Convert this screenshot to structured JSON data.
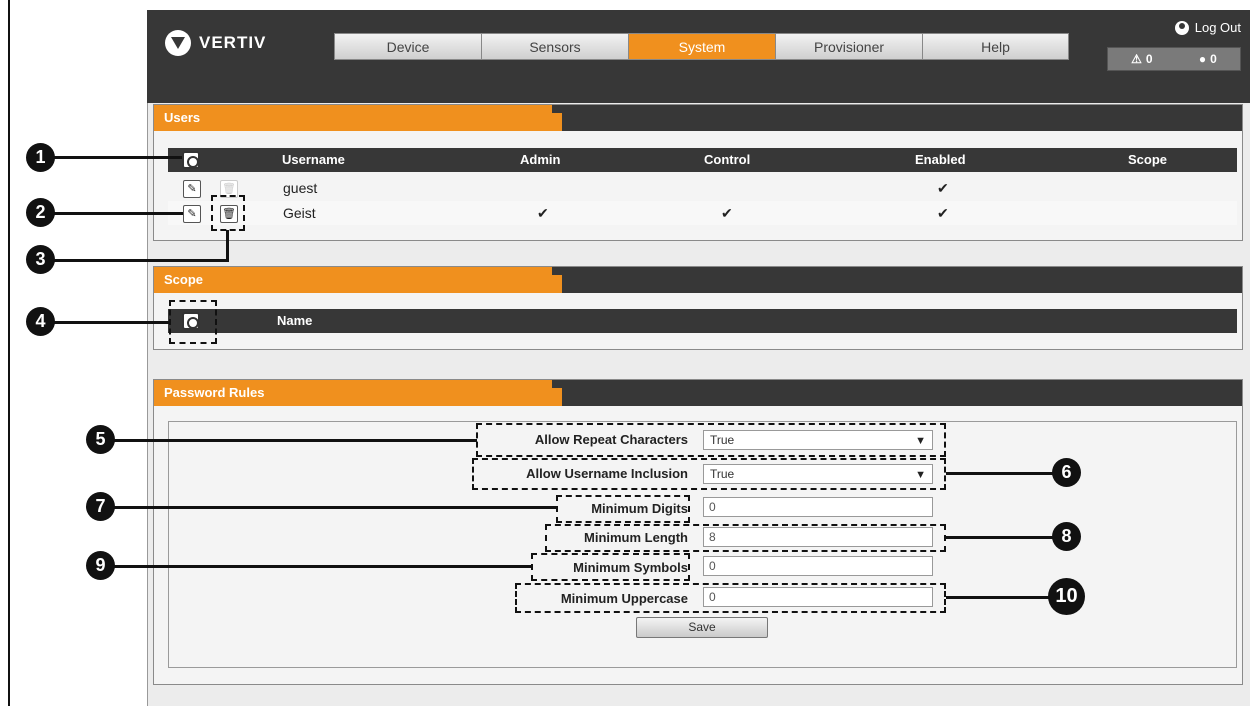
{
  "header": {
    "brand": "VERTIV",
    "tabs": [
      {
        "label": "Device",
        "active": false
      },
      {
        "label": "Sensors",
        "active": false
      },
      {
        "label": "System",
        "active": true
      },
      {
        "label": "Provisioner",
        "active": false
      },
      {
        "label": "Help",
        "active": false
      }
    ],
    "logout_label": "Log Out",
    "alarm_warning_count": "0",
    "alarm_info_count": "0"
  },
  "users": {
    "title": "Users",
    "columns": {
      "username": "Username",
      "admin": "Admin",
      "control": "Control",
      "enabled": "Enabled",
      "scope": "Scope"
    },
    "rows": [
      {
        "username": "guest",
        "admin": "",
        "control": "",
        "enabled": "✔",
        "scope": ""
      },
      {
        "username": "Geist",
        "admin": "✔",
        "control": "✔",
        "enabled": "✔",
        "scope": ""
      }
    ]
  },
  "scope": {
    "title": "Scope",
    "columns": {
      "name": "Name"
    }
  },
  "password_rules": {
    "title": "Password Rules",
    "allow_repeat_label": "Allow Repeat Characters",
    "allow_repeat_value": "True",
    "allow_username_label": "Allow Username Inclusion",
    "allow_username_value": "True",
    "min_digits_label": "Minimum Digits",
    "min_digits_value": "0",
    "min_length_label": "Minimum Length",
    "min_length_value": "8",
    "min_symbols_label": "Minimum Symbols",
    "min_symbols_value": "0",
    "min_uppercase_label": "Minimum Uppercase",
    "min_uppercase_value": "0",
    "save_label": "Save"
  },
  "callouts": [
    "1",
    "2",
    "3",
    "4",
    "5",
    "6",
    "7",
    "8",
    "9",
    "10"
  ],
  "colors": {
    "accent": "#f0901e",
    "dark": "#373737",
    "panel": "#f4f4f4"
  }
}
